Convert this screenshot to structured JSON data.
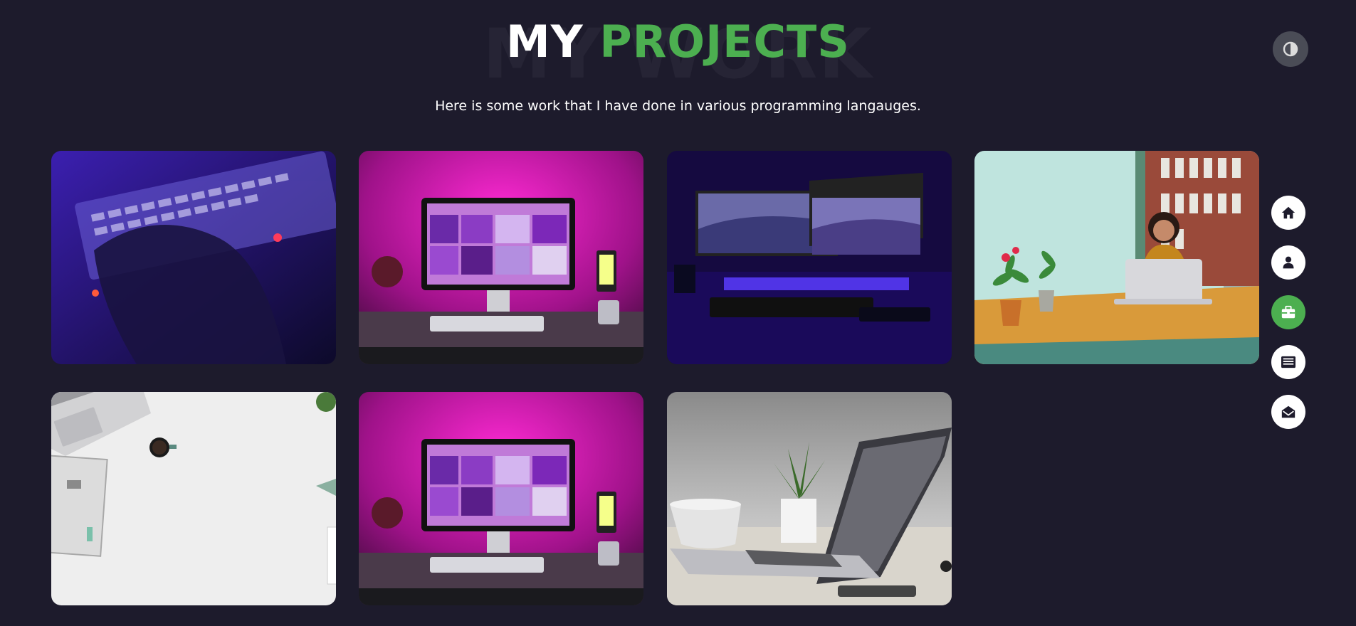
{
  "header": {
    "watermark": "MY WORK",
    "title_plain": "MY",
    "title_accent": "PROJECTS",
    "subtitle": "Here is some work that I have done in various programming langauges."
  },
  "colors": {
    "background": "#1d1b2c",
    "accent": "#4caf50",
    "nav_button": "#ffffff",
    "theme_toggle": "#4a4c56"
  },
  "theme_toggle": {
    "icon": "contrast-icon"
  },
  "projects": [
    {
      "image": "hands-typing-purple-keyboard"
    },
    {
      "image": "imac-magenta-desk"
    },
    {
      "image": "dual-monitors-purple-setup"
    },
    {
      "image": "woman-with-laptop"
    },
    {
      "image": "white-desk-flatlay"
    },
    {
      "image": "imac-magenta-desk"
    },
    {
      "image": "laptop-plant-cup"
    }
  ],
  "nav": [
    {
      "icon": "home-icon",
      "active": false
    },
    {
      "icon": "user-icon",
      "active": false
    },
    {
      "icon": "briefcase-icon",
      "active": true
    },
    {
      "icon": "newspaper-icon",
      "active": false
    },
    {
      "icon": "envelope-open-icon",
      "active": false
    }
  ]
}
